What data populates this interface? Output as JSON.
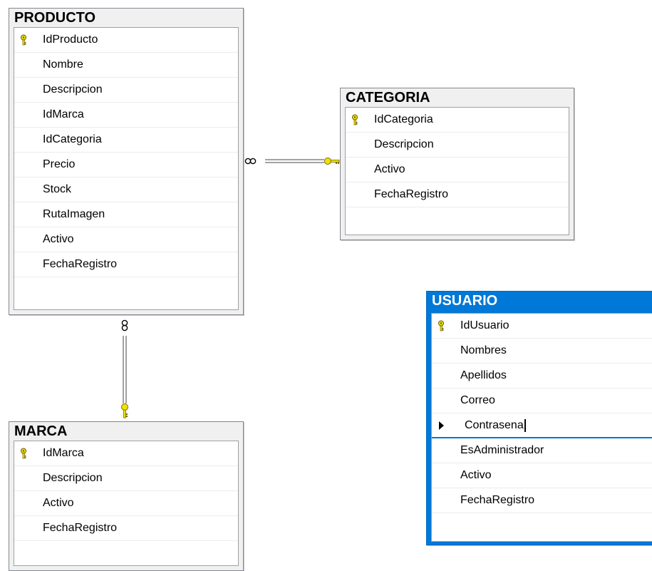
{
  "tables": {
    "producto": {
      "title": "PRODUCTO",
      "columns": [
        "IdProducto",
        "Nombre",
        "Descripcion",
        "IdMarca",
        "IdCategoria",
        "Precio",
        "Stock",
        "RutaImagen",
        "Activo",
        "FechaRegistro"
      ],
      "primary_key": "IdProducto"
    },
    "categoria": {
      "title": "CATEGORIA",
      "columns": [
        "IdCategoria",
        "Descripcion",
        "Activo",
        "FechaRegistro"
      ],
      "primary_key": "IdCategoria"
    },
    "marca": {
      "title": "MARCA",
      "columns": [
        "IdMarca",
        "Descripcion",
        "Activo",
        "FechaRegistro"
      ],
      "primary_key": "IdMarca"
    },
    "usuario": {
      "title": "USUARIO",
      "columns": [
        "IdUsuario",
        "Nombres",
        "Apellidos",
        "Correo",
        "Contrasena",
        "EsAdministrador",
        "Activo",
        "FechaRegistro"
      ],
      "primary_key": "IdUsuario",
      "current_row": "Contrasena",
      "selected": true
    }
  },
  "relationships": [
    {
      "from": "PRODUCTO",
      "to": "CATEGORIA",
      "many_end": "PRODUCTO",
      "key_end": "CATEGORIA"
    },
    {
      "from": "PRODUCTO",
      "to": "MARCA",
      "many_end": "PRODUCTO",
      "key_end": "MARCA"
    }
  ],
  "colors": {
    "selected_header": "#0078d7",
    "key_icon": "#e8d400",
    "window_border": "#828790"
  }
}
